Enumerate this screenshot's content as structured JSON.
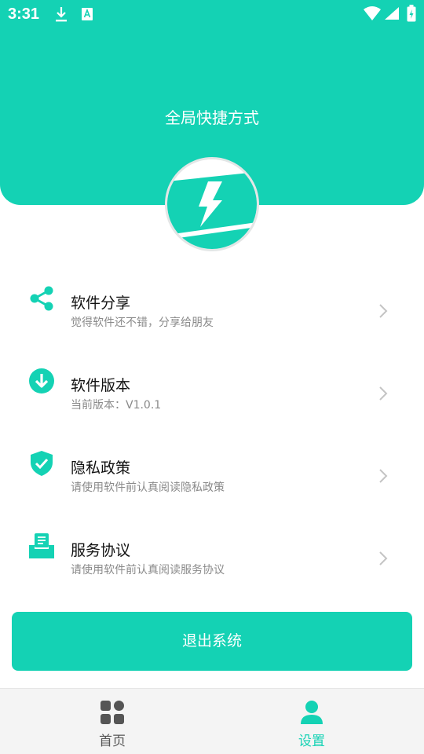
{
  "status_bar": {
    "time": "3:31"
  },
  "header": {
    "title": "全局快捷方式"
  },
  "menu": [
    {
      "title": "软件分享",
      "subtitle": "觉得软件还不错，分享给朋友",
      "icon": "share-icon"
    },
    {
      "title": "软件版本",
      "subtitle": "当前版本：V1.0.1",
      "icon": "download-circle-icon"
    },
    {
      "title": "隐私政策",
      "subtitle": "请使用软件前认真阅读隐私政策",
      "icon": "shield-check-icon"
    },
    {
      "title": "服务协议",
      "subtitle": "请使用软件前认真阅读服务协议",
      "icon": "document-tray-icon"
    }
  ],
  "logout_label": "退出系统",
  "bottom_nav": {
    "home_label": "首页",
    "settings_label": "设置",
    "active": "settings"
  },
  "colors": {
    "accent": "#14d2b4",
    "text_primary": "#111111",
    "text_secondary": "#8a8a8a",
    "nav_inactive": "#555555",
    "nav_background": "#f4f4f4"
  }
}
